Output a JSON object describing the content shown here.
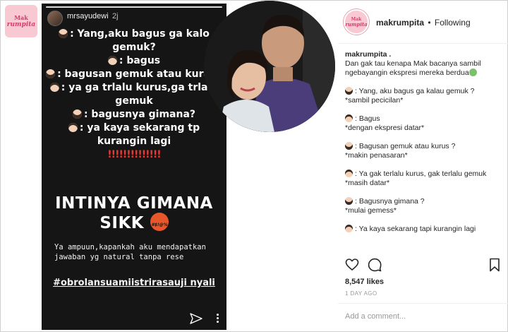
{
  "watermark": {
    "line1": "Mak",
    "line2": "rumpita"
  },
  "story": {
    "username": "mrsayudewi",
    "time": "2j",
    "lines": [
      {
        "speaker": "woman",
        "text": ": Yang,aku bagus ga kalo gemuk?"
      },
      {
        "speaker": "man",
        "text": ": bagus"
      },
      {
        "speaker": "woman",
        "text": ": bagusan gemuk atau kurus?"
      },
      {
        "speaker": "man",
        "text": ": ya ga trlalu kurus,ga trlalu gemuk"
      },
      {
        "speaker": "woman",
        "text": ": bagusnya gimana?"
      },
      {
        "speaker": "man",
        "text": ": ya kaya sekarang tp kurangin lagi"
      }
    ],
    "exclamations": "!!!!!!!!!!!!!!",
    "headline": "INTINYA GIMANA SIKK",
    "caption": "Ya ampuun,kapankah aku mendapatkan jawaban yg natural tanpa rese",
    "hashtag": "#obrolansuamiistrirasauji nyali",
    "icons": {
      "send": "send-icon",
      "more": "more-vertical-icon"
    }
  },
  "post": {
    "account": "makrumpita",
    "separator": "•",
    "follow_status": "Following",
    "author": "makrumpita .",
    "intro": "Dan gak tau kenapa Mak bacanya sambil ngebayangin ekspresi mereka berdua",
    "dialogue": [
      {
        "speaker": "woman",
        "line": ": Yang, aku bagus ga kalau gemuk ?",
        "note": "*sambil pecicilan*"
      },
      {
        "speaker": "man",
        "line": ": Bagus",
        "note": "*dengan ekspresi datar*"
      },
      {
        "speaker": "woman",
        "line": ": Bagusan gemuk atau kurus ?",
        "note": "*makin penasaran*"
      },
      {
        "speaker": "man",
        "line": ": Ya gak terlalu kurus, gak terlalu gemuk",
        "note": "*masih datar*"
      },
      {
        "speaker": "woman",
        "line": ": Bagusnya gimana ?",
        "note": "*mulai gemess*"
      },
      {
        "speaker": "man",
        "line": ": Ya kaya sekarang tapi kurangin lagi",
        "note": ""
      }
    ],
    "likes": "8,547 likes",
    "date": "1 DAY AGO",
    "comment_placeholder": "Add a comment...",
    "icons": {
      "like": "heart-icon",
      "comment": "comment-icon",
      "save": "bookmark-icon"
    }
  },
  "colors": {
    "story_bg": "#151515",
    "brand_pink": "#d23c69",
    "exclaim_red": "#e53935"
  }
}
